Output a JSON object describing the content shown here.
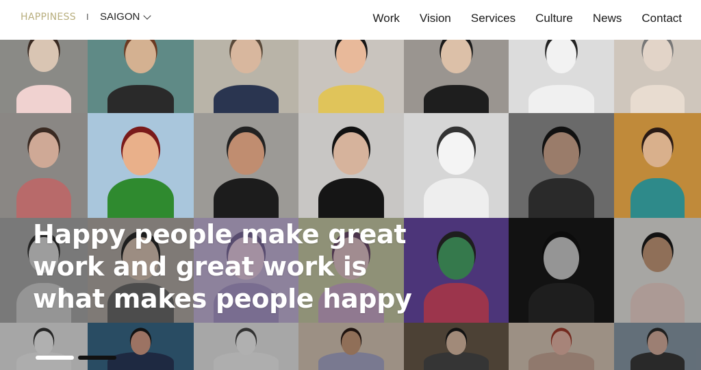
{
  "header": {
    "logo": "HAPPINESS",
    "separator": "I",
    "city": "SAIGON"
  },
  "nav": {
    "items": [
      "Work",
      "Vision",
      "Services",
      "Culture",
      "News",
      "Contact"
    ]
  },
  "hero": {
    "lines": [
      "Happy people make great",
      "work and great work is",
      "what makes people happy"
    ]
  },
  "carousel": {
    "slide_count": 2,
    "active_index": 0
  },
  "colors": {
    "logo": "#b8ae7e",
    "dot_active": "#ffffff",
    "dot_inactive": "#111111"
  }
}
